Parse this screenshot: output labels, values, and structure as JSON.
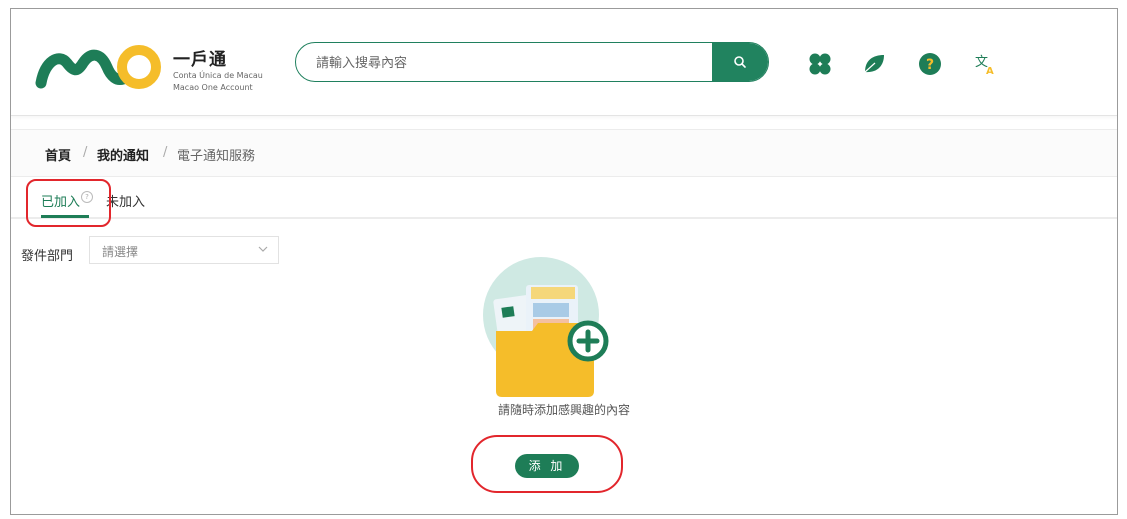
{
  "brand": {
    "title": "一戶通",
    "subtitle_pt": "Conta Única de Macau",
    "subtitle_en": "Macao One Account"
  },
  "search": {
    "placeholder": "請輸入搜尋內容"
  },
  "header_icons": [
    "clover-icon",
    "leaf-icon",
    "help-icon",
    "translate-icon"
  ],
  "breadcrumb": {
    "home": "首頁",
    "separator": "/",
    "my_notifications": "我的通知",
    "current": "電子通知服務"
  },
  "tabs": [
    {
      "label": "已加入",
      "help": "?",
      "active": true
    },
    {
      "label": "未加入",
      "active": false
    }
  ],
  "filter": {
    "label": "發件部門",
    "placeholder": "請選擇"
  },
  "empty_state": {
    "message": "請隨時添加感興趣的內容",
    "add_button": "添 加"
  },
  "colors": {
    "primary": "#1e7d57",
    "accent_yellow": "#f5bd2a",
    "annotation": "#e2262c"
  }
}
